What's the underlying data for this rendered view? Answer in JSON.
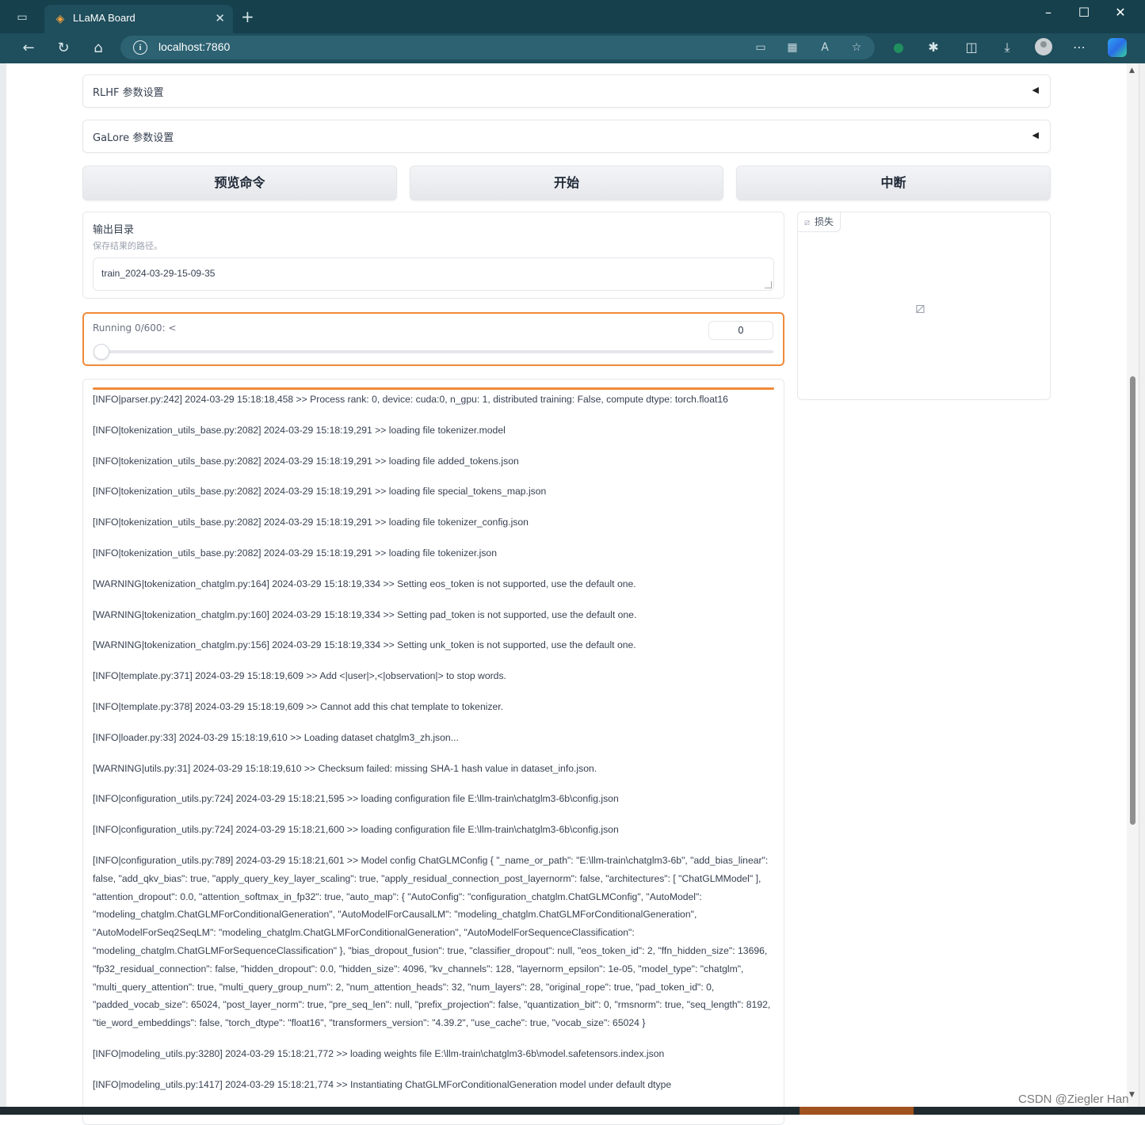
{
  "browser": {
    "tab_title": "LLaMA Board",
    "url": "localhost:7860",
    "icons": [
      "tab-actions-icon",
      "llama-board-favicon",
      "close-tab-icon",
      "new-tab-icon",
      "minimize-icon",
      "maximize-icon",
      "close-window-icon",
      "back-icon",
      "reload-icon",
      "home-icon",
      "site-info-icon",
      "app-available-icon",
      "extensions-grid-icon",
      "read-aloud-icon",
      "favorite-star-icon",
      "extension-icon",
      "puzzle-icon",
      "split-screen-icon",
      "download-icon",
      "profile-avatar",
      "more-menu-icon",
      "copilot-icon"
    ]
  },
  "accordions": [
    {
      "label": "RLHF 参数设置",
      "arrow": "◀"
    },
    {
      "label": "GaLore 参数设置",
      "arrow": "◀"
    }
  ],
  "buttons": {
    "preview": "预览命令",
    "start": "开始",
    "abort": "中断"
  },
  "output_dir": {
    "label": "输出目录",
    "info": "保存结果的路径。",
    "value": "train_2024-03-29-15-09-35"
  },
  "progress": {
    "label": "Running 0/600: <",
    "value": "0",
    "fraction": 0
  },
  "loss_plot": {
    "label": "损失"
  },
  "logs": [
    "[INFO|parser.py:242] 2024-03-29 15:18:18,458 >> Process rank: 0, device: cuda:0, n_gpu: 1, distributed training: False, compute dtype: torch.float16",
    "[INFO|tokenization_utils_base.py:2082] 2024-03-29 15:18:19,291 >> loading file tokenizer.model",
    "[INFO|tokenization_utils_base.py:2082] 2024-03-29 15:18:19,291 >> loading file added_tokens.json",
    "[INFO|tokenization_utils_base.py:2082] 2024-03-29 15:18:19,291 >> loading file special_tokens_map.json",
    "[INFO|tokenization_utils_base.py:2082] 2024-03-29 15:18:19,291 >> loading file tokenizer_config.json",
    "[INFO|tokenization_utils_base.py:2082] 2024-03-29 15:18:19,291 >> loading file tokenizer.json",
    "[WARNING|tokenization_chatglm.py:164] 2024-03-29 15:18:19,334 >> Setting eos_token is not supported, use the default one.",
    "[WARNING|tokenization_chatglm.py:160] 2024-03-29 15:18:19,334 >> Setting pad_token is not supported, use the default one.",
    "[WARNING|tokenization_chatglm.py:156] 2024-03-29 15:18:19,334 >> Setting unk_token is not supported, use the default one.",
    "[INFO|template.py:371] 2024-03-29 15:18:19,609 >> Add <|user|>,<|observation|> to stop words.",
    "[INFO|template.py:378] 2024-03-29 15:18:19,609 >> Cannot add this chat template to tokenizer.",
    "[INFO|loader.py:33] 2024-03-29 15:18:19,610 >> Loading dataset chatglm3_zh.json...",
    "[WARNING|utils.py:31] 2024-03-29 15:18:19,610 >> Checksum failed: missing SHA-1 hash value in dataset_info.json.",
    "[INFO|configuration_utils.py:724] 2024-03-29 15:18:21,595 >> loading configuration file E:\\llm-train\\chatglm3-6b\\config.json",
    "[INFO|configuration_utils.py:724] 2024-03-29 15:18:21,600 >> loading configuration file E:\\llm-train\\chatglm3-6b\\config.json",
    "[INFO|configuration_utils.py:789] 2024-03-29 15:18:21,601 >> Model config ChatGLMConfig { \"_name_or_path\": \"E:\\llm-train\\chatglm3-6b\", \"add_bias_linear\": false, \"add_qkv_bias\": true, \"apply_query_key_layer_scaling\": true, \"apply_residual_connection_post_layernorm\": false, \"architectures\": [ \"ChatGLMModel\" ], \"attention_dropout\": 0.0, \"attention_softmax_in_fp32\": true, \"auto_map\": { \"AutoConfig\": \"configuration_chatglm.ChatGLMConfig\", \"AutoModel\": \"modeling_chatglm.ChatGLMForConditionalGeneration\", \"AutoModelForCausalLM\": \"modeling_chatglm.ChatGLMForConditionalGeneration\", \"AutoModelForSeq2SeqLM\": \"modeling_chatglm.ChatGLMForConditionalGeneration\", \"AutoModelForSequenceClassification\": \"modeling_chatglm.ChatGLMForSequenceClassification\" }, \"bias_dropout_fusion\": true, \"classifier_dropout\": null, \"eos_token_id\": 2, \"ffn_hidden_size\": 13696, \"fp32_residual_connection\": false, \"hidden_dropout\": 0.0, \"hidden_size\": 4096, \"kv_channels\": 128, \"layernorm_epsilon\": 1e-05, \"model_type\": \"chatglm\", \"multi_query_attention\": true, \"multi_query_group_num\": 2, \"num_attention_heads\": 32, \"num_layers\": 28, \"original_rope\": true, \"pad_token_id\": 0, \"padded_vocab_size\": 65024, \"post_layer_norm\": true, \"pre_seq_len\": null, \"prefix_projection\": false, \"quantization_bit\": 0, \"rmsnorm\": true, \"seq_length\": 8192, \"tie_word_embeddings\": false, \"torch_dtype\": \"float16\", \"transformers_version\": \"4.39.2\", \"use_cache\": true, \"vocab_size\": 65024 }",
    "[INFO|modeling_utils.py:3280] 2024-03-29 15:18:21,772 >> loading weights file E:\\llm-train\\chatglm3-6b\\model.safetensors.index.json",
    "[INFO|modeling_utils.py:1417] 2024-03-29 15:18:21,774 >> Instantiating ChatGLMForConditionalGeneration model under default dtype"
  ],
  "watermark": "CSDN @Ziegler Han",
  "colors": {
    "accent": "#f08a3a",
    "chrome": "#1f4e5c"
  }
}
